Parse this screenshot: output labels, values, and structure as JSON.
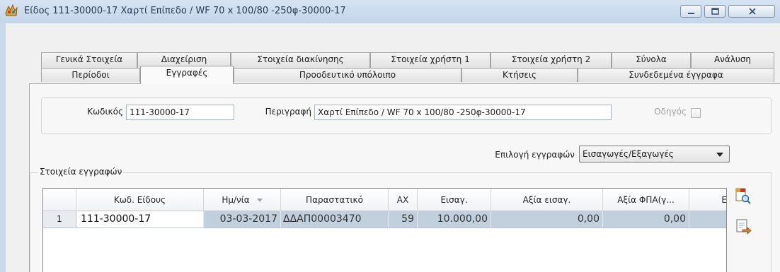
{
  "window": {
    "title": "Είδος 111-30000-17  Χαρτί Επίπεδο / WF 70 x 100/80 -250φ-30000-17"
  },
  "tabs_row1": [
    {
      "label": "Γενικά Στοιχεία"
    },
    {
      "label": "Διαχείριση"
    },
    {
      "label": "Στοιχεία διακίνησης"
    },
    {
      "label": "Στοιχεία χρήστη 1"
    },
    {
      "label": "Στοιχεία χρήστη 2"
    },
    {
      "label": "Σύνολα"
    },
    {
      "label": "Ανάλυση"
    }
  ],
  "tabs_row2": [
    {
      "label": "Περίοδοι"
    },
    {
      "label": "Εγγραφές",
      "active": true
    },
    {
      "label": "Προοδευτικό υπόλοιπο"
    },
    {
      "label": "Κτήσεις"
    },
    {
      "label": "Συνδεδεμένα έγγραφα"
    }
  ],
  "form": {
    "code_label": "Κωδικός",
    "code_value": "111-30000-17",
    "description_label": "Περιγραφή",
    "description_value": "Χαρτί Επίπεδο / WF 70 x 100/80 -250φ-30000-17",
    "guide_label": "Οδηγός",
    "guide_checked": false,
    "records_select_label": "Επιλογή εγγραφών",
    "records_select_value": "Εισαγωγές/Εξαγωγές"
  },
  "records_group": {
    "legend": "Στοιχεία εγγραφών"
  },
  "grid": {
    "columns": [
      "",
      "Κωδ. Είδους",
      "Ημ/νία",
      "Παραστατικό",
      "ΑΧ",
      "Εισαγ.",
      "Αξία εισαγ.",
      "Αξία ΦΠΑ(γ...",
      "E"
    ],
    "sorted_column": "Ημ/νία",
    "rows": [
      {
        "row_no": "1",
        "item_code": "111-30000-17",
        "date": "03-03-2017",
        "document": "ΔΔΑΠ00003470",
        "ax": "59",
        "import_qty": "10.000,00",
        "import_value": "0,00",
        "vat_value": "0,00",
        "extra": ""
      }
    ]
  },
  "side_tools": [
    {
      "icon": "search-document-icon"
    },
    {
      "icon": "export-document-icon"
    }
  ],
  "colors": {
    "selected_row": "#c2cfdc",
    "frame": "#c9d9ec",
    "client": "#f0f0f0"
  }
}
